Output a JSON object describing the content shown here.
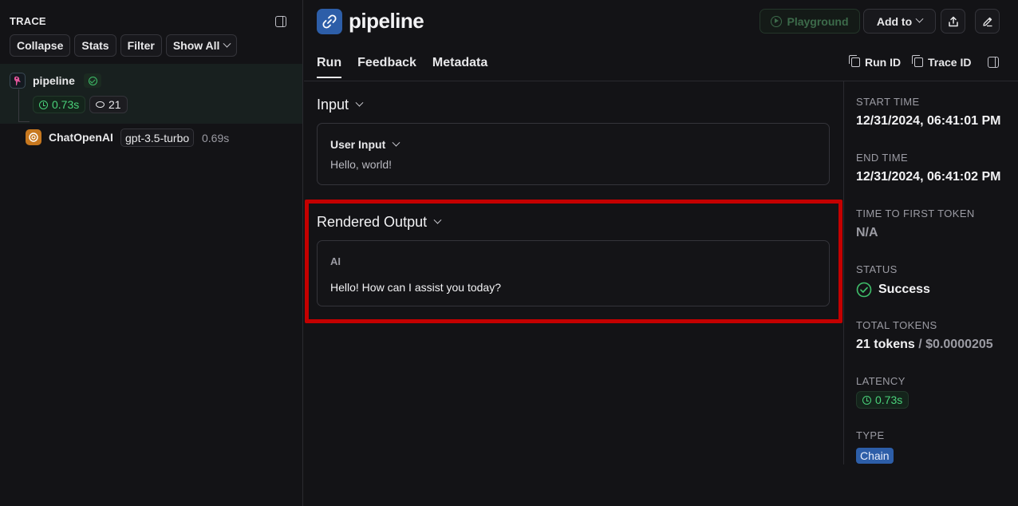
{
  "trace_panel": {
    "title": "TRACE",
    "toolbar": {
      "collapse": "Collapse",
      "stats": "Stats",
      "filter": "Filter",
      "show_all": "Show All"
    },
    "root_node": {
      "name": "pipeline",
      "latency": "0.73s",
      "tokens": "21"
    },
    "child_node": {
      "name": "ChatOpenAI",
      "model": "gpt-3.5-turbo",
      "latency": "0.69s"
    }
  },
  "header": {
    "title": "pipeline",
    "playground_label": "Playground",
    "add_to_label": "Add to",
    "tabs": [
      "Run",
      "Feedback",
      "Metadata"
    ],
    "run_id_label": "Run ID",
    "trace_id_label": "Trace ID"
  },
  "input_section": {
    "title": "Input",
    "field_label": "User Input",
    "field_value": "Hello, world!"
  },
  "output_section": {
    "title": "Rendered Output",
    "role": "AI",
    "message": "Hello! How can I assist you today?"
  },
  "metadata": {
    "start_time_label": "START TIME",
    "start_time": "12/31/2024, 06:41:01 PM",
    "end_time_label": "END TIME",
    "end_time": "12/31/2024, 06:41:02 PM",
    "ttft_label": "TIME TO FIRST TOKEN",
    "ttft": "N/A",
    "status_label": "STATUS",
    "status": "Success",
    "total_tokens_label": "TOTAL TOKENS",
    "total_tokens": "21 tokens",
    "total_cost": "/ $0.0000205",
    "latency_label": "LATENCY",
    "latency": "0.73s",
    "type_label": "TYPE",
    "type": "Chain"
  },
  "colors": {
    "accent_blue": "#2d5ea8",
    "success_green": "#3fbe6a",
    "highlight_red": "#c40000"
  }
}
